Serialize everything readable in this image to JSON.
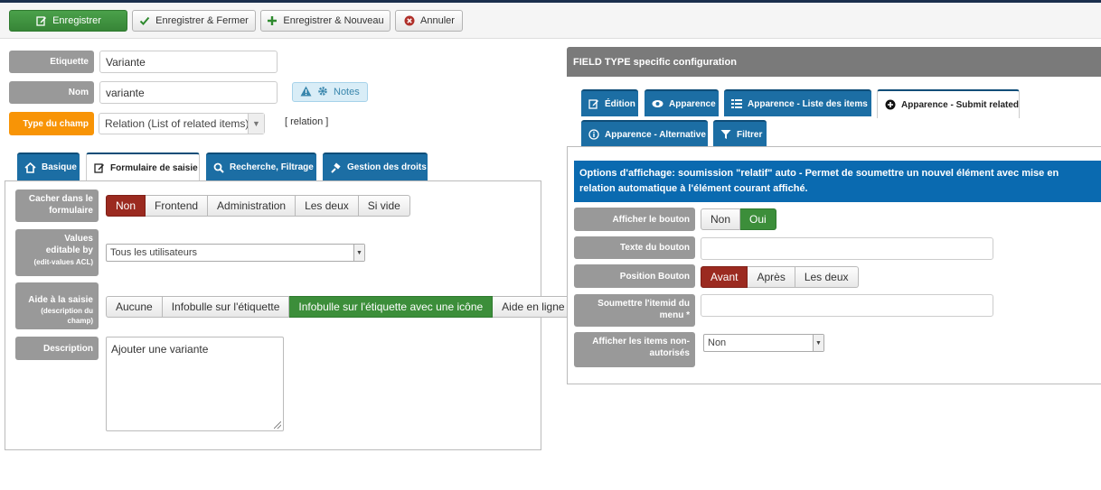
{
  "toolbar": {
    "save": "Enregistrer",
    "save_close": "Enregistrer & Fermer",
    "save_new": "Enregistrer & Nouveau",
    "cancel": "Annuler"
  },
  "fields": {
    "label_label": "Etiquette",
    "label_value": "Variante",
    "name_label": "Nom",
    "name_value": "variante",
    "notes": "Notes",
    "type_label": "Type du champ",
    "type_value": "Relation (List of related items)",
    "type_code": "[ relation ]"
  },
  "left_tabs": [
    "Basique",
    "Formulaire de saisie",
    "Recherche, Filtrage",
    "Gestion des droits"
  ],
  "form": {
    "hide_label": "Cacher dans le formulaire",
    "hide_options": [
      "Non",
      "Frontend",
      "Administration",
      "Les deux",
      "Si vide"
    ],
    "editable_label": "Values editable by",
    "editable_sub": "(edit-values ACL)",
    "editable_value": "Tous les utilisateurs",
    "help_label": "Aide à la saisie",
    "help_sub": "(description du champ)",
    "help_options": [
      "Aucune",
      "Infobulle sur l'étiquette",
      "Infobulle sur l'étiquette avec une icône",
      "Aide en ligne"
    ],
    "desc_label": "Description",
    "desc_value": "Ajouter une variante"
  },
  "right": {
    "header": "FIELD TYPE specific configuration",
    "tabs": [
      "Édition",
      "Apparence",
      "Apparence - Liste des items",
      "Apparence - Submit related",
      "Apparence - Alternative",
      "Filtrer"
    ],
    "info": "Options d'affichage: soumission \"relatif\" auto - Permet de soumettre un nouvel élément avec mise en relation automatique à l'élément courant affiché.",
    "show_btn_label": "Afficher le bouton",
    "show_btn_options": [
      "Non",
      "Oui"
    ],
    "btn_text_label": "Texte du bouton",
    "btn_pos_label": "Position Bouton",
    "btn_pos_options": [
      "Avant",
      "Après",
      "Les deux"
    ],
    "itemid_label": "Soumettre l'itemid du menu *",
    "unauth_label": "Afficher les items non-autorisés",
    "unauth_value": "Non"
  },
  "colors": {
    "accent_blue": "#1c6ea4",
    "green": "#3c8e3a",
    "red": "#9b2a20",
    "orange": "#f89406"
  }
}
